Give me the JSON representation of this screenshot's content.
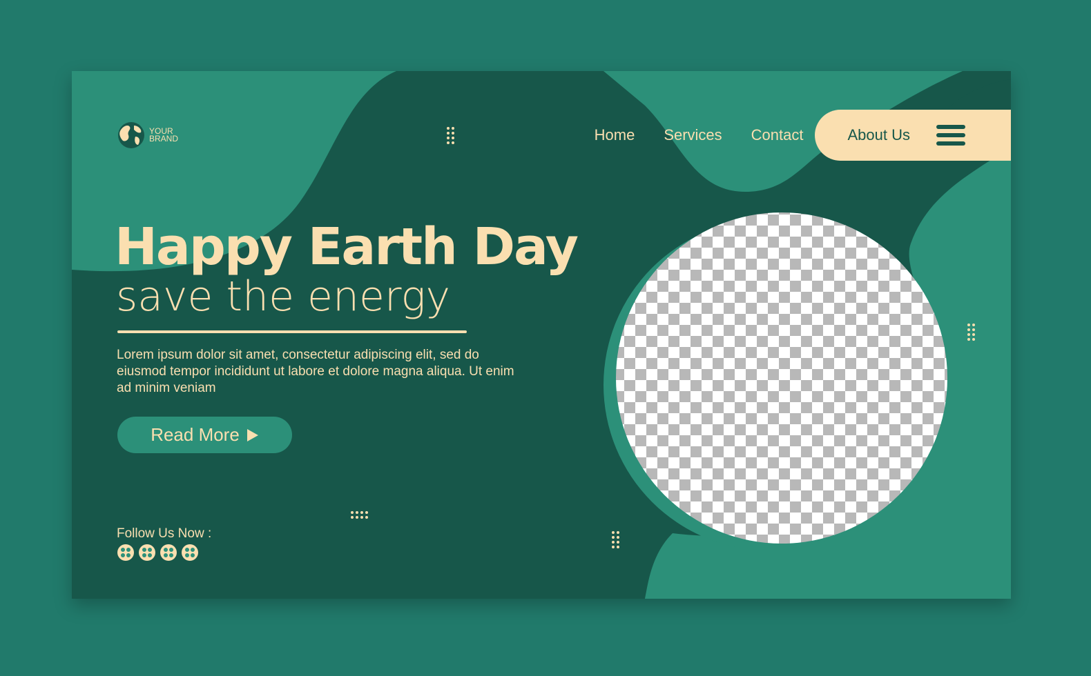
{
  "brand": {
    "line1": "YOUR",
    "line2": "BRAND",
    "icon": "globe-icon"
  },
  "nav": {
    "items": [
      "Home",
      "Services",
      "Contact"
    ],
    "about": "About Us",
    "menu_icon": "hamburger-icon"
  },
  "hero": {
    "title": "Happy Earth Day",
    "subtitle": "save the energy",
    "body": "Lorem ipsum dolor sit amet, consectetur adipiscing elit, sed do eiusmod tempor incididunt ut labore et dolore magna aliqua. Ut enim ad minim veniam",
    "cta": "Read More",
    "cta_icon": "play-icon"
  },
  "follow": {
    "label": "Follow Us Now :",
    "icons": [
      "social-icon",
      "social-icon",
      "social-icon",
      "social-icon"
    ]
  },
  "colors": {
    "background": "#217a6b",
    "dark": "#17574a",
    "teal": "#2c9079",
    "cream": "#fadfb0"
  }
}
